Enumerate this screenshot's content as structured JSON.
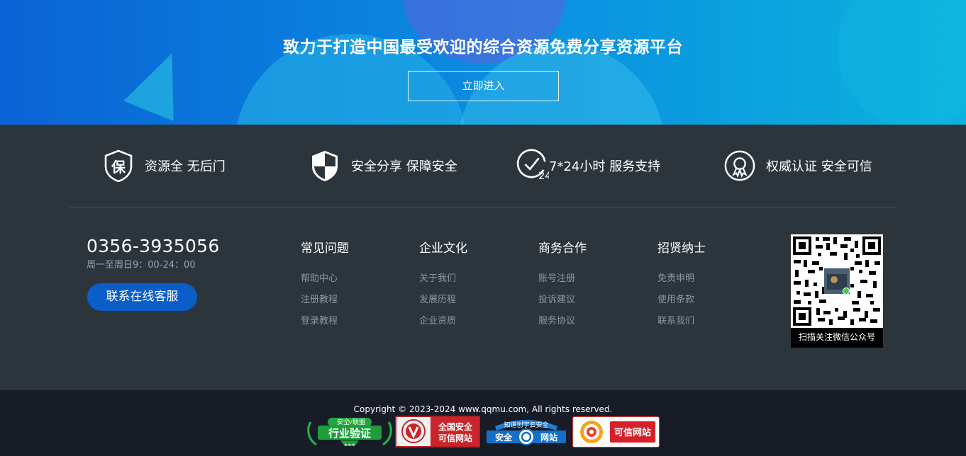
{
  "hero": {
    "slogan": "致力于打造中国最受欢迎的综合资源免费分享资源平台",
    "enter_label": "立即进入"
  },
  "features": [
    {
      "icon": "shield-bao-icon",
      "label": "资源全 无后门"
    },
    {
      "icon": "security-shield-icon",
      "label": "安全分享 保障安全"
    },
    {
      "icon": "clock-24-icon",
      "label": "7*24小时 服务支持"
    },
    {
      "icon": "award-badge-icon",
      "label": "权威认证 安全可信"
    }
  ],
  "contact": {
    "phone": "0356-3935056",
    "hours": "周一至周日9：00-24：00",
    "service_label": "联系在线客服"
  },
  "columns": [
    {
      "title": "常见问题",
      "links": [
        "帮助中心",
        "注册教程",
        "登录教程"
      ]
    },
    {
      "title": "企业文化",
      "links": [
        "关于我们",
        "发展历程",
        "企业资质"
      ]
    },
    {
      "title": "商务合作",
      "links": [
        "账号注册",
        "投诉建议",
        "服务协议"
      ]
    },
    {
      "title": "招贤纳士",
      "links": [
        "免责申明",
        "使用条款",
        "联系我们"
      ]
    }
  ],
  "qr": {
    "caption": "扫描关注微信公众号"
  },
  "footer": {
    "copyright": "Copyright © 2023-2024 www.qqmu.com, All rights reserved.",
    "badges": [
      {
        "top": "安全",
        "mid": "联盟",
        "main": "行业验证"
      },
      {
        "line1": "全国安全",
        "line2": "可信网站"
      },
      {
        "top": "知道创宇云安全",
        "left": "安全",
        "right": "网站"
      },
      {
        "main": "可信网站"
      }
    ]
  },
  "colors": {
    "accent": "#0b5ec7",
    "panel": "#2d353c",
    "bottom": "#171c27"
  }
}
